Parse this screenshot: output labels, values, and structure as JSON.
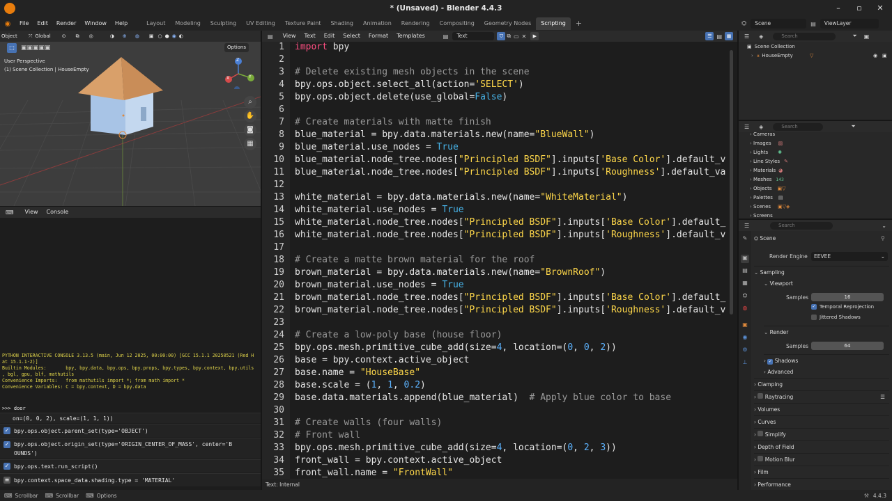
{
  "window": {
    "title": "* (Unsaved) - Blender 4.4.3",
    "controls": [
      "–",
      "▫",
      "✕"
    ]
  },
  "menu": {
    "items": [
      "File",
      "Edit",
      "Render",
      "Window",
      "Help"
    ],
    "workspaces": [
      "Layout",
      "Modeling",
      "Sculpting",
      "UV Editing",
      "Texture Paint",
      "Shading",
      "Animation",
      "Rendering",
      "Compositing",
      "Geometry Nodes",
      "Scripting"
    ],
    "active_workspace": "Scripting",
    "add_tab": "+"
  },
  "scene_bar": {
    "scene": "Scene",
    "view_layer": "ViewLayer"
  },
  "viewport": {
    "mode": "Object",
    "transform": "Global",
    "options": "Options",
    "perspective": "User Perspective",
    "collection_info": "(1) Scene Collection | HouseEmpty",
    "axes": {
      "x": "X",
      "y": "Y",
      "z": "Z"
    }
  },
  "console": {
    "menu": [
      "View",
      "Console"
    ],
    "lines": [
      "PYTHON INTERACTIVE CONSOLE 3.13.5 (main, Jun 12 2025, 00:00:00) [GCC 15.1.1 20250521 (Red H",
      "at 15.1.1-2)]",
      "",
      "Builtin Modules:       bpy, bpy.data, bpy.ops, bpy.props, bpy.types, bpy.context, bpy.utils",
      ", bgl, gpu, blf, mathutils",
      "Convenience Imports:   from mathutils import *; from math import *",
      "Convenience Variables: C = bpy.context, D = bpy.data"
    ],
    "prompt": ">>> door",
    "history": [
      {
        "text": "on=(0, 0, 2), scale=(1, 1, 1))",
        "icon": ""
      },
      {
        "text": "bpy.ops.object.parent_set(type='OBJECT')",
        "icon": "check"
      },
      {
        "text": "bpy.ops.object.origin_set(type='ORIGIN_CENTER_OF_MASS', center='B",
        "icon": "check",
        "cont": "OUNDS')"
      },
      {
        "text": "bpy.ops.text.run_script()",
        "icon": "check"
      },
      {
        "text": "bpy.context.space_data.shading.type = 'MATERIAL'",
        "icon": "info"
      }
    ]
  },
  "editor": {
    "menu": [
      "View",
      "Text",
      "Edit",
      "Select",
      "Format",
      "Templates"
    ],
    "text_name": "Text",
    "footer": "Text: Internal",
    "lines": [
      {
        "n": "1",
        "t": "import bpy"
      },
      {
        "n": "2",
        "t": ""
      },
      {
        "n": "3",
        "t": "# Delete existing mesh objects in the scene"
      },
      {
        "n": "4",
        "t": "bpy.ops.object.select_all(action='SELECT')"
      },
      {
        "n": "5",
        "t": "bpy.ops.object.delete(use_global=False)"
      },
      {
        "n": "6",
        "t": ""
      },
      {
        "n": "7",
        "t": "# Create materials with matte finish"
      },
      {
        "n": "8",
        "t": "blue_material = bpy.data.materials.new(name=\"BlueWall\")"
      },
      {
        "n": "9",
        "t": "blue_material.use_nodes = True"
      },
      {
        "n": "10",
        "t": "blue_material.node_tree.nodes[\"Principled BSDF\"].inputs['Base Color'].default_v"
      },
      {
        "n": "11",
        "t": "blue_material.node_tree.nodes[\"Principled BSDF\"].inputs['Roughness'].default_va"
      },
      {
        "n": "12",
        "t": ""
      },
      {
        "n": "13",
        "t": "white_material = bpy.data.materials.new(name=\"WhiteMaterial\")"
      },
      {
        "n": "14",
        "t": "white_material.use_nodes = True"
      },
      {
        "n": "15",
        "t": "white_material.node_tree.nodes[\"Principled BSDF\"].inputs['Base Color'].default_"
      },
      {
        "n": "16",
        "t": "white_material.node_tree.nodes[\"Principled BSDF\"].inputs['Roughness'].default_v"
      },
      {
        "n": "17",
        "t": ""
      },
      {
        "n": "18",
        "t": "# Create a matte brown material for the roof"
      },
      {
        "n": "19",
        "t": "brown_material = bpy.data.materials.new(name=\"BrownRoof\")"
      },
      {
        "n": "20",
        "t": "brown_material.use_nodes = True"
      },
      {
        "n": "21",
        "t": "brown_material.node_tree.nodes[\"Principled BSDF\"].inputs['Base Color'].default_"
      },
      {
        "n": "22",
        "t": "brown_material.node_tree.nodes[\"Principled BSDF\"].inputs['Roughness'].default_v"
      },
      {
        "n": "23",
        "t": ""
      },
      {
        "n": "24",
        "t": "# Create a low-poly base (house floor)"
      },
      {
        "n": "25",
        "t": "bpy.ops.mesh.primitive_cube_add(size=4, location=(0, 0, 2))"
      },
      {
        "n": "26",
        "t": "base = bpy.context.active_object"
      },
      {
        "n": "27",
        "t": "base.name = \"HouseBase\""
      },
      {
        "n": "28",
        "t": "base.scale = (1, 1, 0.2)"
      },
      {
        "n": "29",
        "t": "base.data.materials.append(blue_material)  # Apply blue color to base"
      },
      {
        "n": "30",
        "t": ""
      },
      {
        "n": "31",
        "t": "# Create walls (four walls)"
      },
      {
        "n": "32",
        "t": "# Front wall"
      },
      {
        "n": "33",
        "t": "bpy.ops.mesh.primitive_cube_add(size=4, location=(0, 2, 3))"
      },
      {
        "n": "34",
        "t": "front_wall = bpy.context.active_object"
      },
      {
        "n": "35",
        "t": "front_wall.name = \"FrontWall\""
      }
    ]
  },
  "outliner": {
    "search_placeholder": "Search",
    "root": "Scene Collection",
    "items": [
      "HouseEmpty"
    ]
  },
  "blendfile": {
    "search_placeholder": "Search",
    "items": [
      "Cameras",
      "Images",
      "Lights",
      "Line Styles",
      "Materials",
      "Meshes",
      "Objects",
      "Palettes",
      "Scenes",
      "Screens"
    ],
    "badges": {
      "Meshes": "143"
    }
  },
  "properties": {
    "search_placeholder": "Search",
    "context": "Scene",
    "render_engine_label": "Render Engine",
    "render_engine": "EEVEE",
    "sampling": "Sampling",
    "viewport": "Viewport",
    "samples_label": "Samples",
    "viewport_samples": "16",
    "temporal_reprojection": "Temporal Reprojection",
    "jittered_shadows": "Jittered Shadows",
    "render": "Render",
    "render_samples": "64",
    "shadows": "Shadows",
    "advanced": "Advanced",
    "sections": [
      "Clamping",
      "Raytracing",
      "Volumes",
      "Curves",
      "Simplify",
      "Depth of Field",
      "Motion Blur",
      "Film",
      "Performance"
    ]
  },
  "status": {
    "items": [
      "Scrollbar",
      "Scrollbar",
      "Options"
    ],
    "version": "4.4.3"
  },
  "colors": {
    "accent": "#4772b3",
    "keyword": "#ff4f82",
    "string": "#ffd84a",
    "number": "#5cb3ff",
    "console_text": "#e0d44a"
  }
}
